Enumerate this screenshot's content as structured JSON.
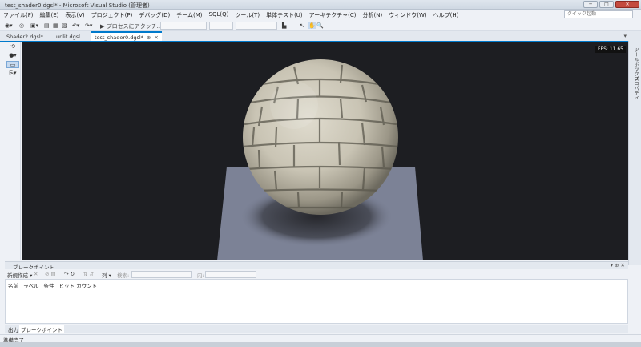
{
  "window": {
    "title": "test_shader0.dgsl* - Microsoft Visual Studio (管理者)",
    "min": "─",
    "max": "□",
    "close": "✕"
  },
  "menu": [
    "ファイル(F)",
    "編集(E)",
    "表示(V)",
    "プロジェクト(P)",
    "デバッグ(D)",
    "チーム(M)",
    "SQL(Q)",
    "ツール(T)",
    "単体テスト(U)",
    "アーキテクチャ(C)",
    "分析(N)",
    "ウィンドウ(W)",
    "ヘルプ(H)"
  ],
  "quick_launch": "クイック起動",
  "toolbar": {
    "attach": "▶ プロセスにアタッチ..."
  },
  "tabs": [
    {
      "label": "Shader2.dgsl*"
    },
    {
      "label": "unlit.dgsl"
    },
    {
      "label": "test_shader0.dgsl*"
    }
  ],
  "viewport": {
    "fps": "FPS: 11.65"
  },
  "right_panels": [
    "ツールボックス",
    "プロパティ"
  ],
  "breakpoints": {
    "title": "ブレークポイント",
    "new": "新規作成 ▾",
    "columns_btn": "列 ▾",
    "search": "検索:",
    "in": "内:",
    "columns": [
      "名前",
      "ラベル",
      "条件",
      "ヒット カウント"
    ]
  },
  "bottom_tabs": [
    "出力",
    "ブレークポイント"
  ],
  "status": "準備完了",
  "colors": {
    "accent": "#007acc",
    "viewport_bg": "#1d1e22",
    "floor": "#7c8296"
  }
}
